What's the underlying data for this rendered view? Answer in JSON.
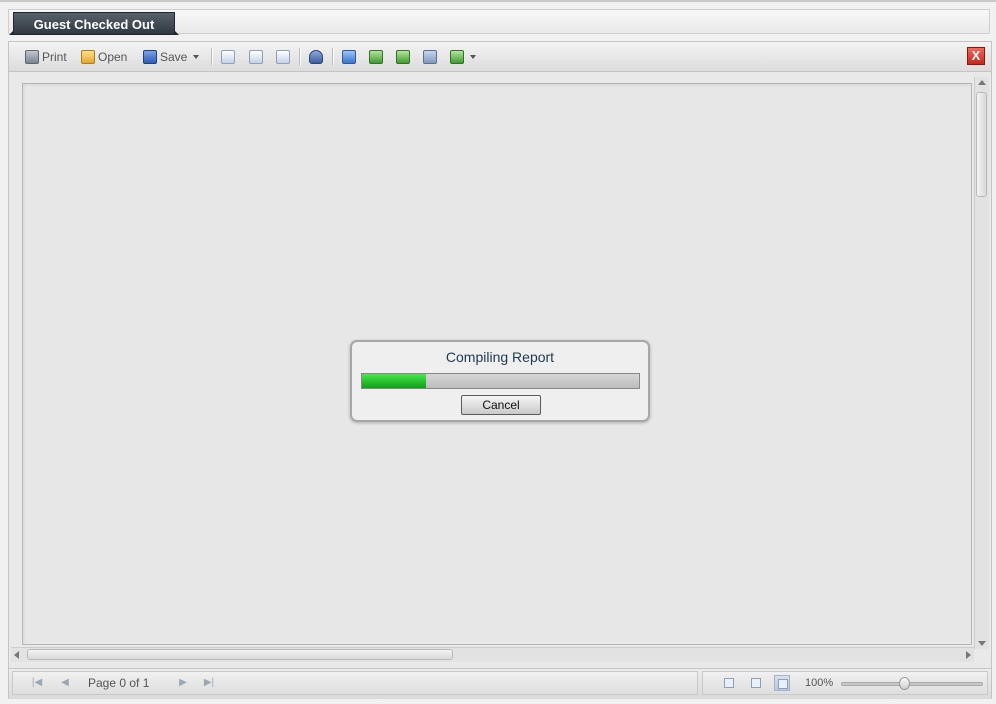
{
  "tab": {
    "title": "Guest Checked Out"
  },
  "toolbar": {
    "print_label": "Print",
    "open_label": "Open",
    "save_label": "Save",
    "close_label": "X"
  },
  "statusbar": {
    "page_label": "Page 0 of 1",
    "zoom_label": "100%",
    "zoom_fraction": 0.45
  },
  "dialog": {
    "title": "Compiling Report",
    "progress_fraction": 0.23,
    "cancel_label": "Cancel"
  },
  "colors": {
    "progress": "#22c02a",
    "close": "#d9342a",
    "tab": "#3f4952"
  }
}
